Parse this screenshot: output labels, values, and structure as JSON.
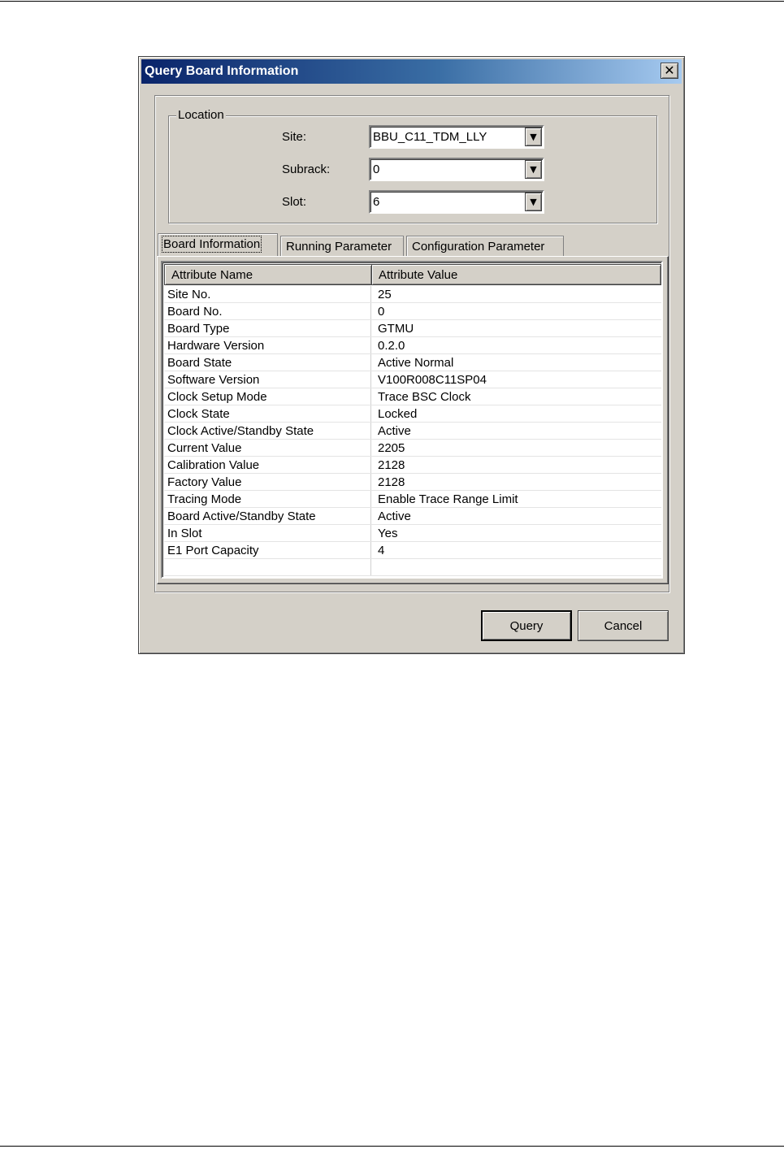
{
  "dialog": {
    "title": "Query Board Information",
    "close_glyph": "✕"
  },
  "location": {
    "group_label": "Location",
    "site_label": "Site:",
    "site_value": "BBU_C11_TDM_LLY",
    "subrack_label": "Subrack:",
    "subrack_value": "0",
    "slot_label": "Slot:",
    "slot_value": "6",
    "dropdown_glyph": "▼"
  },
  "tabs": [
    {
      "label": "Board Information",
      "active": true
    },
    {
      "label": "Running Parameter",
      "active": false
    },
    {
      "label": "Configuration Parameter",
      "active": false
    }
  ],
  "table": {
    "columns": [
      "Attribute Name",
      "Attribute Value"
    ],
    "rows": [
      [
        "Site No.",
        "25"
      ],
      [
        "Board No.",
        "0"
      ],
      [
        "Board Type",
        "GTMU"
      ],
      [
        "Hardware Version",
        "0.2.0"
      ],
      [
        "Board State",
        "Active Normal"
      ],
      [
        "Software Version",
        "V100R008C11SP04"
      ],
      [
        "Clock Setup Mode",
        "Trace BSC Clock"
      ],
      [
        "Clock State",
        "Locked"
      ],
      [
        "Clock Active/Standby State",
        "Active"
      ],
      [
        "Current Value",
        "2205"
      ],
      [
        "Calibration Value",
        "2128"
      ],
      [
        "Factory Value",
        "2128"
      ],
      [
        "Tracing Mode",
        "Enable Trace Range Limit"
      ],
      [
        "Board Active/Standby State",
        "Active"
      ],
      [
        "In Slot",
        "Yes"
      ],
      [
        "E1 Port Capacity",
        "4"
      ],
      [
        "",
        ""
      ]
    ]
  },
  "buttons": {
    "query_label": "Query",
    "cancel_label": "Cancel"
  },
  "colors": {
    "title_bar_start": "#0a246a",
    "title_bar_end": "#a6caf0",
    "window_face": "#d4d0c8"
  },
  "icons": {
    "close": "close-icon",
    "dropdown": "chevron-down-icon"
  }
}
